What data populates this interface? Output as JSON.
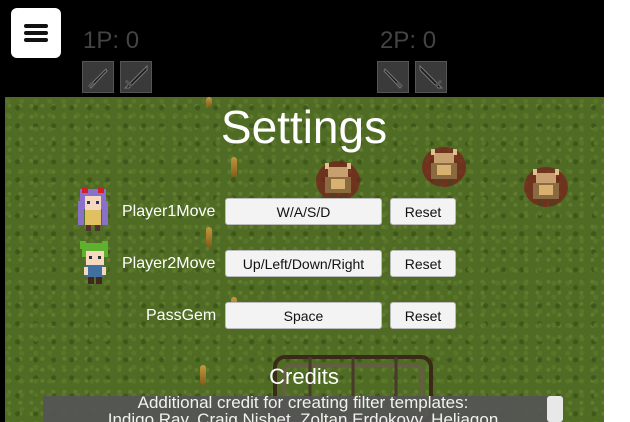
{
  "hud": {
    "p1_score": "1P: 0",
    "p2_score": "2P: 0",
    "menu_icon": "hamburger-menu-icon",
    "weapon_icons": [
      "dagger-icon",
      "sword-icon",
      "dagger-icon",
      "sword-icon"
    ]
  },
  "settings": {
    "title": "Settings",
    "rows": [
      {
        "label": "Player1Move",
        "key": "W/A/S/D",
        "reset": "Reset",
        "avatar": "purple-haired-girl-sprite"
      },
      {
        "label": "Player2Move",
        "key": "Up/Left/Down/Right",
        "reset": "Reset",
        "avatar": "green-haired-boy-sprite"
      },
      {
        "label": "PassGem",
        "key": "Space",
        "reset": "Reset"
      }
    ]
  },
  "credits": {
    "title": "Credits",
    "line1": "Additional credit for creating filter templates:",
    "line2": "Indigo Ray, Craig Nisbet, Zoltan Erdokovy, Heliagon"
  },
  "colors": {
    "grass": "#4f6b24",
    "button_bg": "#f3f3f3",
    "hud_text": "#444444"
  }
}
